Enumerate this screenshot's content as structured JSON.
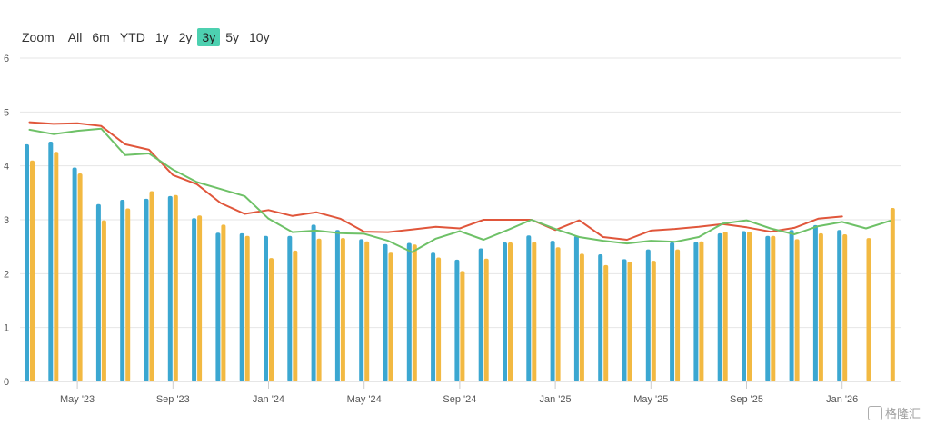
{
  "zoom": {
    "label": "Zoom",
    "options": [
      "All",
      "6m",
      "YTD",
      "1y",
      "2y",
      "3y",
      "5y",
      "10y"
    ],
    "active": "3y",
    "active_color": "#4dd0b0"
  },
  "watermark": {
    "text": "格隆汇"
  },
  "chart_data": {
    "type": "bar",
    "title": "",
    "ylim": [
      0,
      6
    ],
    "yticks": [
      0,
      1,
      2,
      3,
      4,
      5,
      6
    ],
    "xticks": [
      "May '23",
      "Sep '23",
      "Jan '24",
      "May '24",
      "Sep '24",
      "Jan '25",
      "May '25",
      "Sep '25",
      "Jan '26"
    ],
    "grid": true,
    "months": [
      "2023-03",
      "2023-04",
      "2023-05",
      "2023-06",
      "2023-07",
      "2023-08",
      "2023-09",
      "2023-10",
      "2023-11",
      "2023-12",
      "2024-01",
      "2024-02",
      "2024-03",
      "2024-04",
      "2024-05",
      "2024-06",
      "2024-07",
      "2024-08",
      "2024-09",
      "2024-10",
      "2024-11",
      "2024-12",
      "2025-01",
      "2025-02",
      "2025-03",
      "2025-04",
      "2025-05",
      "2025-06",
      "2025-07",
      "2025-08",
      "2025-09",
      "2025-10",
      "2025-11",
      "2025-12",
      "2026-01",
      "2026-02",
      "2026-03"
    ],
    "series": [
      {
        "type": "bar",
        "color": "#3ba7d1",
        "values": [
          4.4,
          4.45,
          3.97,
          3.29,
          3.37,
          3.39,
          3.44,
          3.03,
          2.76,
          2.75,
          2.7,
          2.7,
          2.91,
          2.81,
          2.64,
          2.55,
          2.57,
          2.39,
          2.26,
          2.47,
          2.58,
          2.71,
          2.61,
          2.7,
          2.36,
          2.27,
          2.45,
          2.58,
          2.59,
          2.75,
          2.79,
          2.7,
          2.81,
          2.9,
          2.81,
          null,
          null
        ]
      },
      {
        "type": "bar",
        "color": "#f2b942",
        "values": [
          4.1,
          4.26,
          3.86,
          2.99,
          3.21,
          3.53,
          3.46,
          3.08,
          2.91,
          2.7,
          2.29,
          2.43,
          2.65,
          2.66,
          2.6,
          2.39,
          2.54,
          2.3,
          2.05,
          2.28,
          2.58,
          2.59,
          2.49,
          2.37,
          2.16,
          2.22,
          2.24,
          2.45,
          2.6,
          2.78,
          2.78,
          2.7,
          2.64,
          2.75,
          2.73,
          2.66,
          3.22
        ]
      },
      {
        "type": "line",
        "color": "#e0563b",
        "values": [
          4.81,
          4.78,
          4.79,
          4.74,
          4.4,
          4.3,
          3.83,
          3.66,
          3.31,
          3.11,
          3.18,
          3.07,
          3.14,
          3.02,
          2.78,
          2.77,
          2.82,
          2.87,
          2.84,
          3.0,
          3.0,
          3.0,
          2.81,
          2.99,
          2.68,
          2.63,
          2.8,
          2.83,
          2.87,
          2.92,
          2.86,
          2.78,
          2.85,
          3.02,
          3.06,
          null,
          null
        ]
      },
      {
        "type": "line",
        "color": "#6ec167",
        "values": [
          4.67,
          4.59,
          4.65,
          4.69,
          4.2,
          4.23,
          3.93,
          3.7,
          3.57,
          3.44,
          3.02,
          2.77,
          2.8,
          2.75,
          2.74,
          2.61,
          2.4,
          2.65,
          2.79,
          2.63,
          2.81,
          3.0,
          2.83,
          2.68,
          2.61,
          2.56,
          2.61,
          2.59,
          2.68,
          2.93,
          2.99,
          2.84,
          2.73,
          2.88,
          2.96,
          2.84,
          2.98
        ]
      }
    ]
  }
}
